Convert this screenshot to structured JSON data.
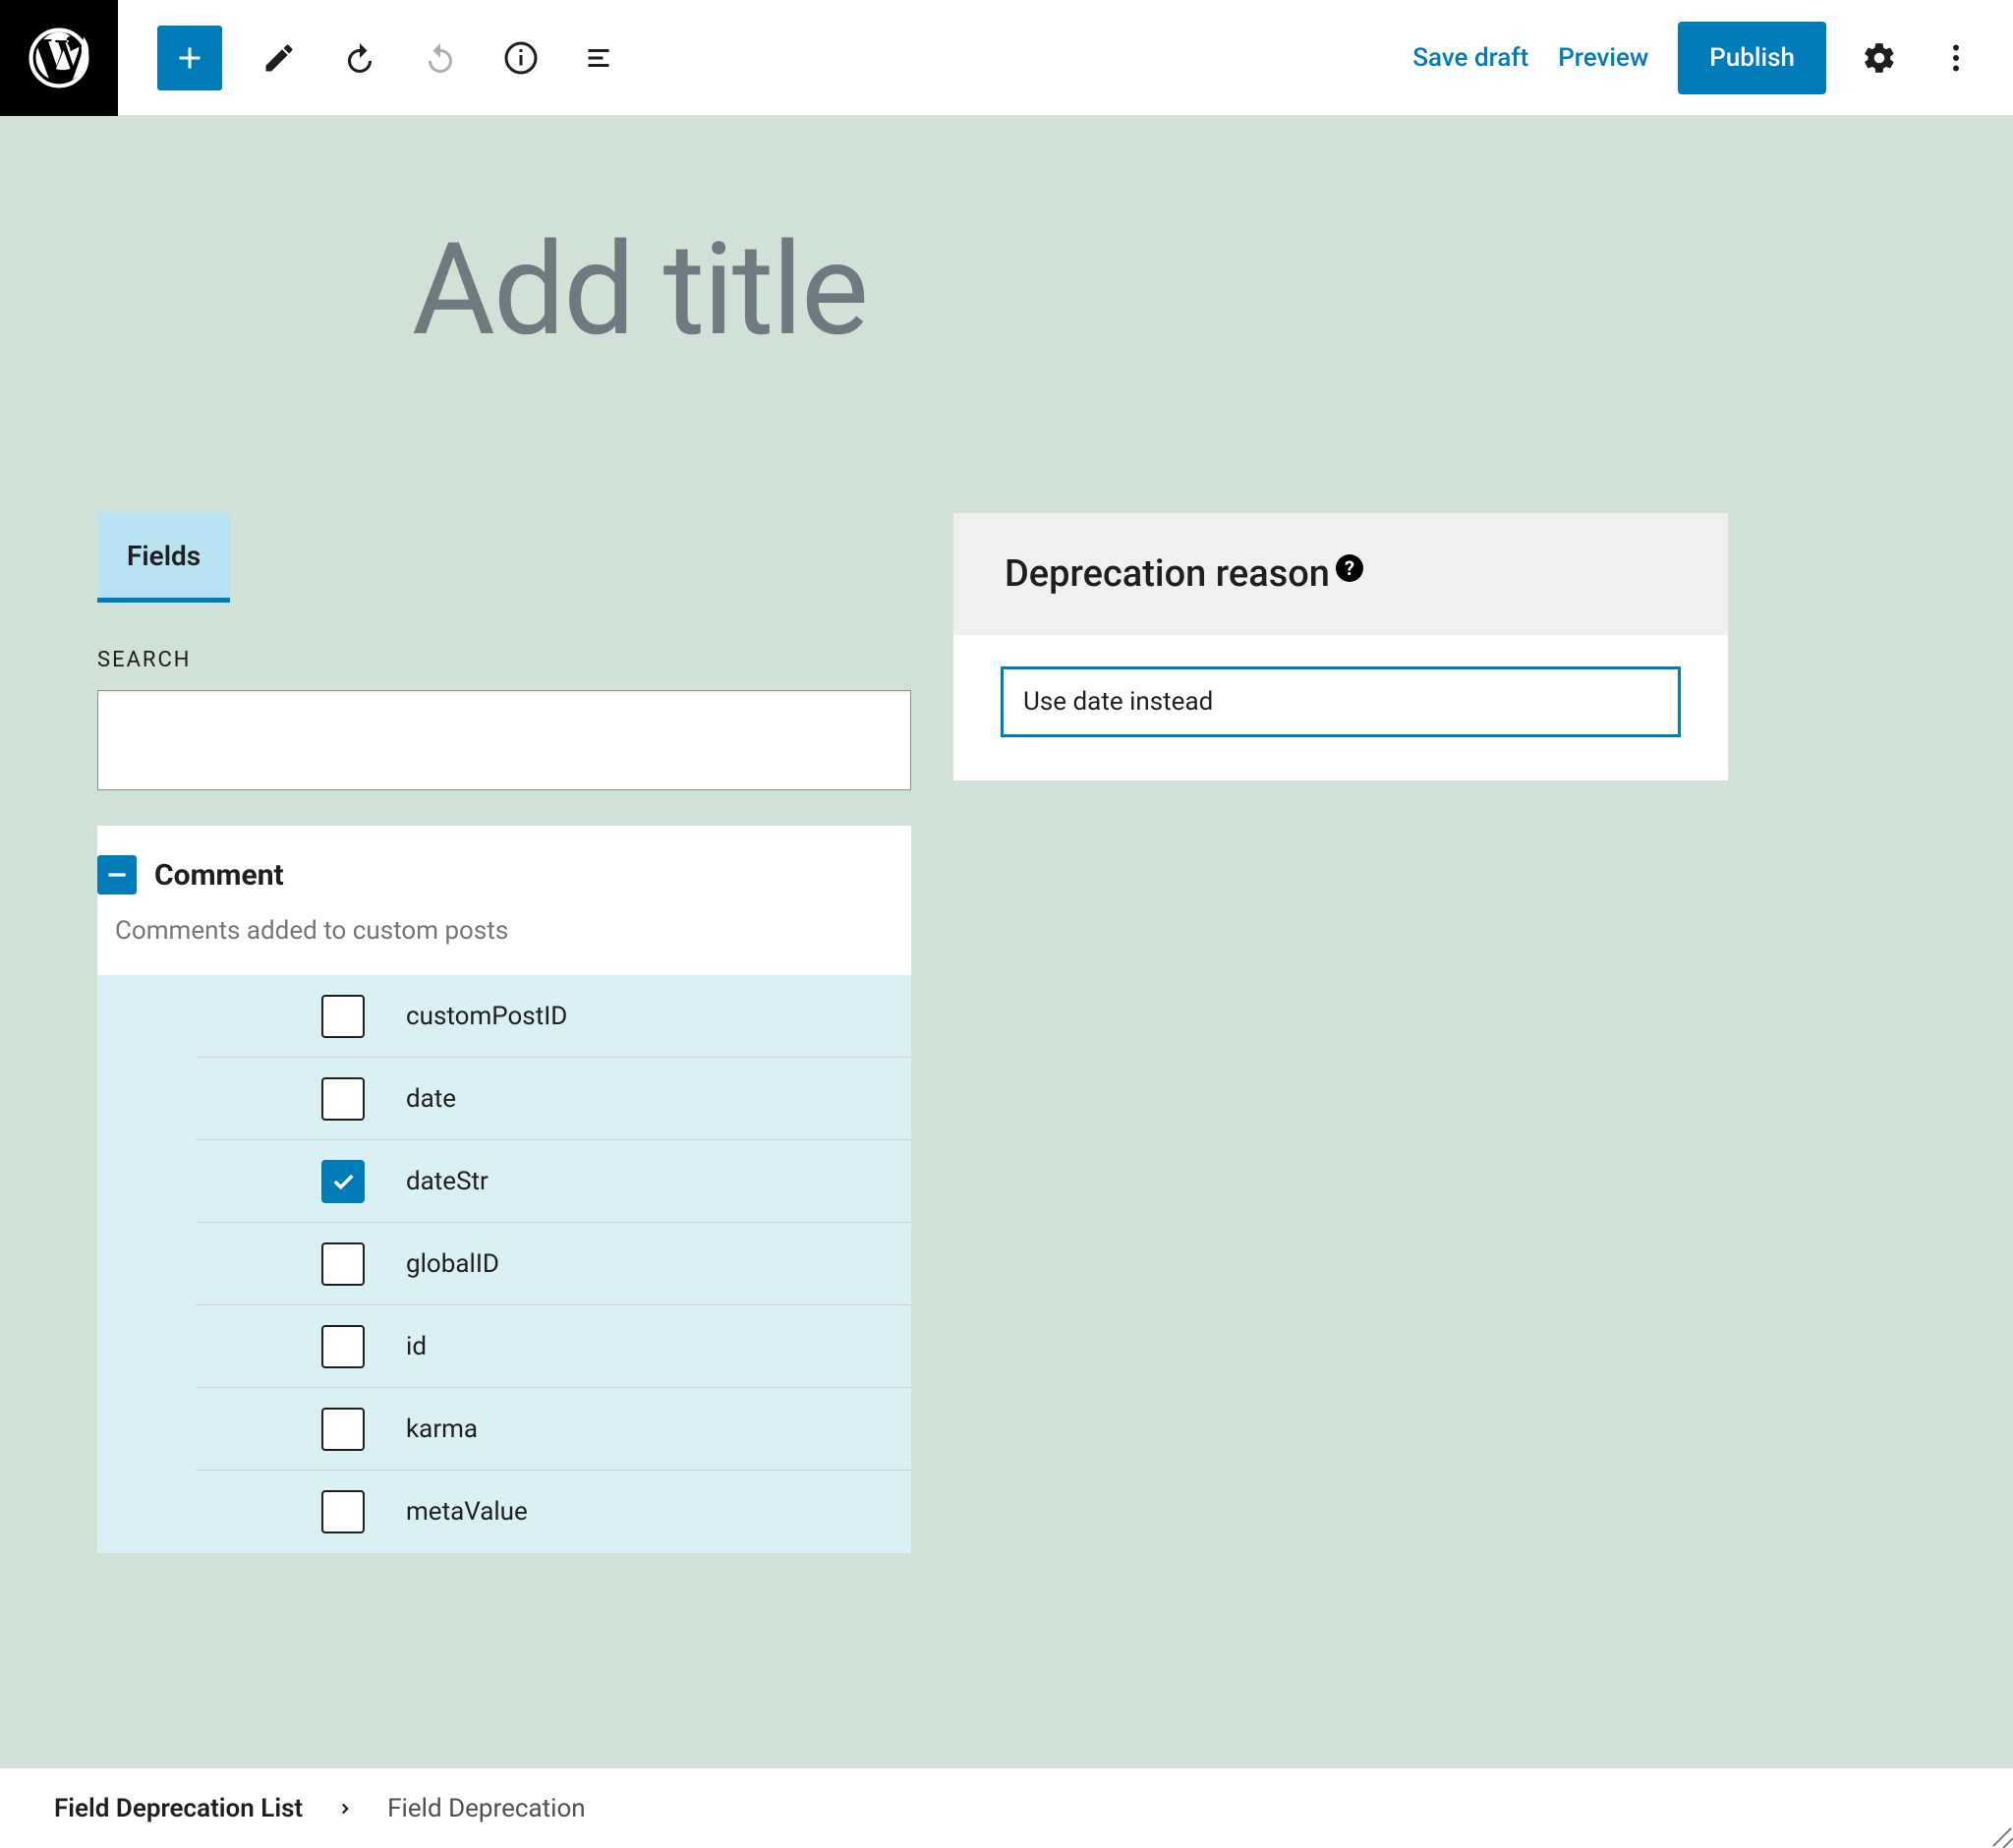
{
  "toolbar": {
    "save_draft": "Save draft",
    "preview": "Preview",
    "publish": "Publish"
  },
  "editor": {
    "title_placeholder": "Add title"
  },
  "tabs": {
    "fields": "Fields"
  },
  "search": {
    "label": "SEARCH",
    "value": ""
  },
  "group": {
    "name": "Comment",
    "description": "Comments added to custom posts"
  },
  "fields": [
    {
      "name": "customPostID",
      "checked": false
    },
    {
      "name": "date",
      "checked": false
    },
    {
      "name": "dateStr",
      "checked": true
    },
    {
      "name": "globalID",
      "checked": false
    },
    {
      "name": "id",
      "checked": false
    },
    {
      "name": "karma",
      "checked": false
    },
    {
      "name": "metaValue",
      "checked": false
    }
  ],
  "panel": {
    "title": "Deprecation reason",
    "value": "Use date instead"
  },
  "breadcrumb": {
    "root": "Field Deprecation List",
    "current": "Field Deprecation"
  }
}
